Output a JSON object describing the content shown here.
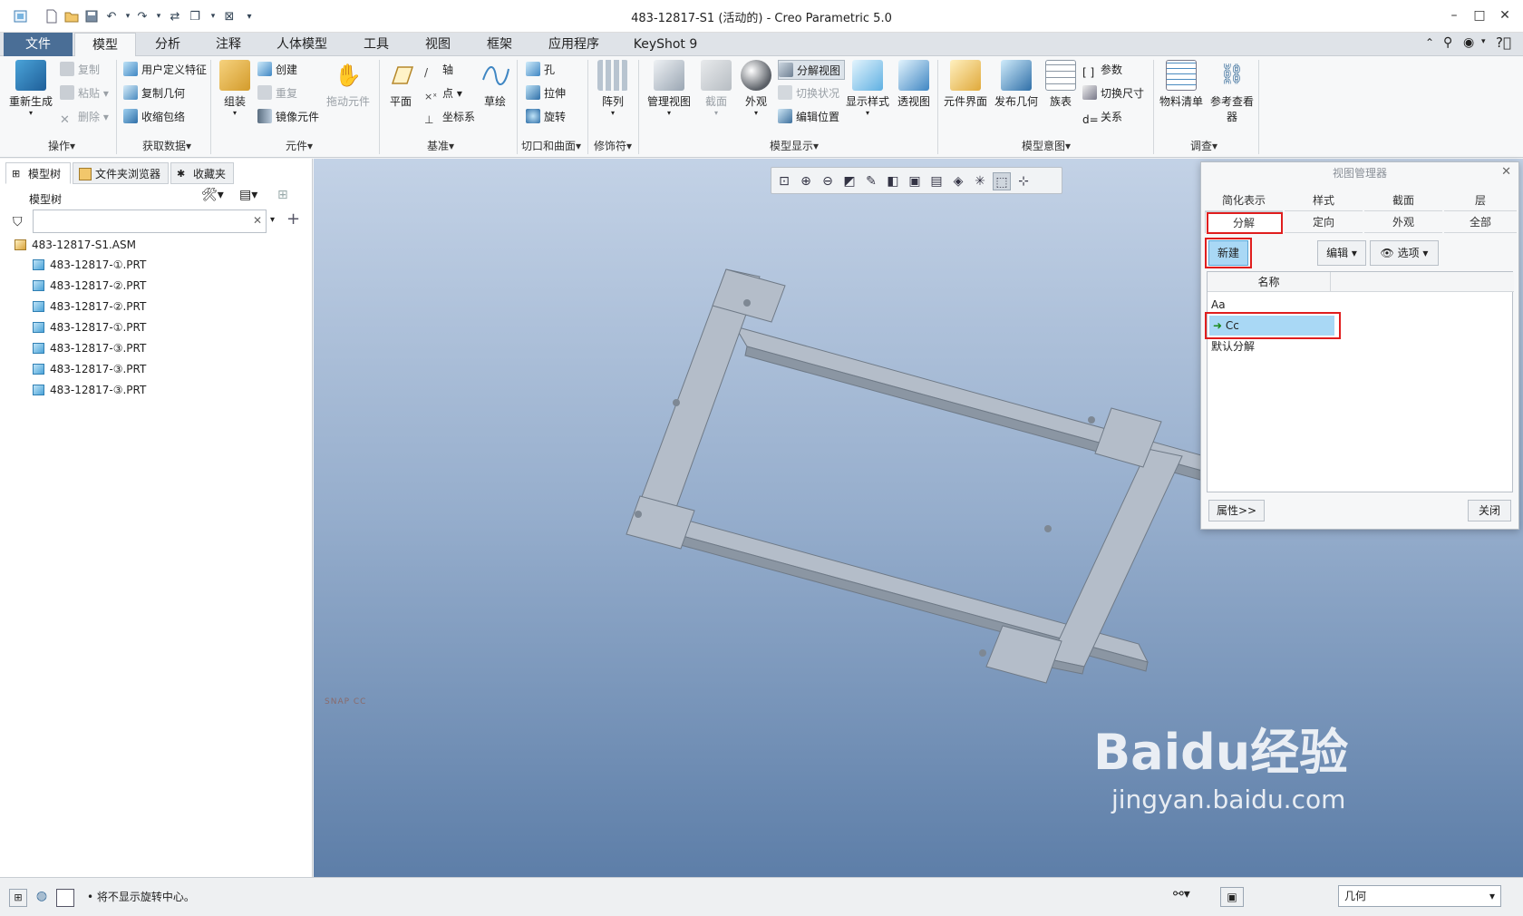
{
  "window": {
    "title": "483-12817-S1 (活动的) - Creo Parametric 5.0"
  },
  "ribbon_tabs": [
    {
      "label": "文件"
    },
    {
      "label": "模型"
    },
    {
      "label": "分析"
    },
    {
      "label": "注释"
    },
    {
      "label": "人体模型"
    },
    {
      "label": "工具"
    },
    {
      "label": "视图"
    },
    {
      "label": "框架"
    },
    {
      "label": "应用程序"
    },
    {
      "label": "KeyShot 9"
    }
  ],
  "ribbon": {
    "operations": {
      "regenerate": "重新生成",
      "copy": "复制",
      "paste": "粘贴",
      "delete": "删除",
      "group": "操作"
    },
    "get_data": {
      "udf": "用户定义特征",
      "copy_geom": "复制几何",
      "shrinkwrap": "收缩包络",
      "group": "获取数据"
    },
    "component": {
      "assemble": "组装",
      "create": "创建",
      "repeat": "重复",
      "mirror": "镜像元件",
      "drag": "拖动元件",
      "group": "元件"
    },
    "datum": {
      "plane": "平面",
      "axis": "轴",
      "point": "点",
      "csys": "坐标系",
      "sketch": "草绘",
      "group": "基准"
    },
    "cuts": {
      "hole": "孔",
      "extrude": "拉伸",
      "revolve": "旋转",
      "group": "切口和曲面"
    },
    "modifiers": {
      "pattern": "阵列",
      "group": "修饰符"
    },
    "model_display": {
      "manage_views": "管理视图",
      "section": "截面",
      "appearance": "外观",
      "explode": "分解视图",
      "toggle_status": "切换状况",
      "edit_position": "编辑位置",
      "display_style": "显示样式",
      "perspective": "透视图",
      "group": "模型显示"
    },
    "model_intent": {
      "comp_interface": "元件界面",
      "publish_geom": "发布几何",
      "family_table": "族表",
      "params": "参数",
      "switch_dims": "切换尺寸",
      "relations": "关系",
      "group": "模型意图"
    },
    "investigate": {
      "bom": "物料清单",
      "ref_viewer_1": "参考查看",
      "ref_viewer_2": "器",
      "group": "调查"
    }
  },
  "left_panel": {
    "tabs": [
      {
        "label": "模型树"
      },
      {
        "label": "文件夹浏览器"
      },
      {
        "label": "收藏夹"
      }
    ],
    "section_title": "模型树",
    "search_placeholder": "",
    "tree": [
      {
        "label": "483-12817-S1.ASM",
        "type": "assembly"
      },
      {
        "label": "483-12817-①.PRT",
        "type": "part"
      },
      {
        "label": "483-12817-②.PRT",
        "type": "part"
      },
      {
        "label": "483-12817-②.PRT",
        "type": "part"
      },
      {
        "label": "483-12817-①.PRT",
        "type": "part"
      },
      {
        "label": "483-12817-③.PRT",
        "type": "part"
      },
      {
        "label": "483-12817-③.PRT",
        "type": "part"
      },
      {
        "label": "483-12817-③.PRT",
        "type": "part"
      }
    ]
  },
  "view_manager": {
    "title": "视图管理器",
    "tabs_row1": [
      "简化表示",
      "样式",
      "截面",
      "层"
    ],
    "tabs_row2": [
      "分解",
      "定向",
      "外观",
      "全部"
    ],
    "new_button": "新建",
    "edit_button": "编辑",
    "options_button": "选项",
    "column_header": "名称",
    "items": [
      {
        "label": "Aa",
        "active": false
      },
      {
        "label": "Cc",
        "active": true
      },
      {
        "label": "默认分解",
        "active": false
      }
    ],
    "properties_button": "属性>>",
    "close_button": "关闭"
  },
  "viewport": {
    "watermark_small": "SNAP CC",
    "watermark_brand": "Baidu经验",
    "watermark_url": "jingyan.baidu.com"
  },
  "status": {
    "message": "将不显示旋转中心。",
    "filter_value": "几何"
  },
  "colors": {
    "file_tab": "#4a6e96",
    "highlight": "#e01e1e",
    "selection": "#a9d8f5"
  }
}
